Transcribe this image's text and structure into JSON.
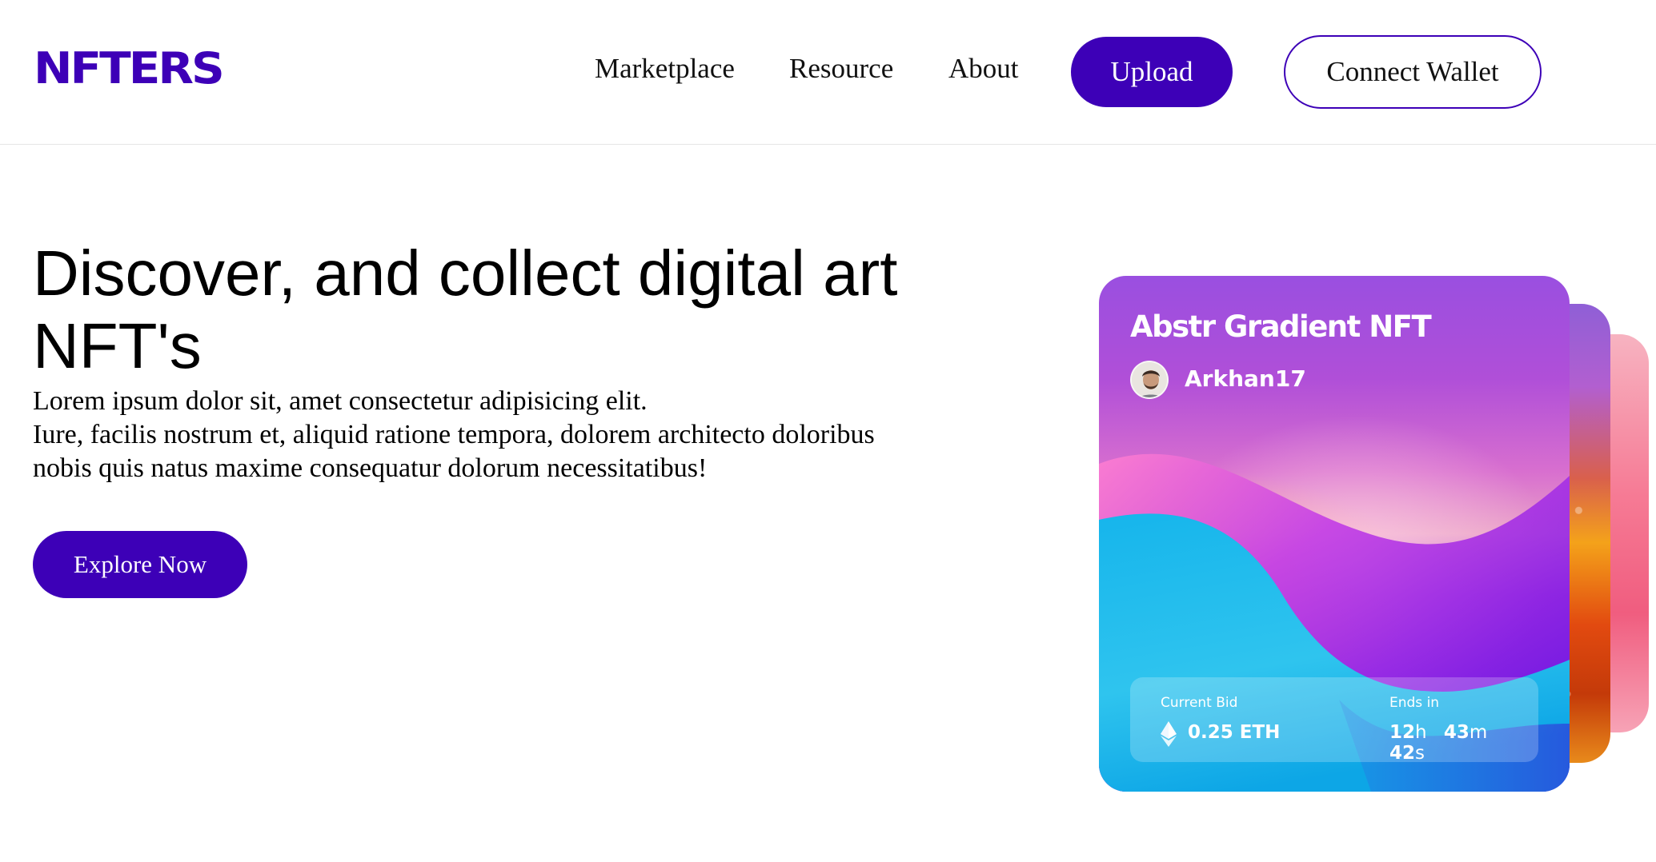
{
  "header": {
    "logo": "NFTERS",
    "nav": [
      "Marketplace",
      "Resource",
      "About"
    ],
    "upload_label": "Upload",
    "wallet_label": "Connect Wallet"
  },
  "hero": {
    "title_line1": "Discover, and collect digital art",
    "title_line2": "NFT's",
    "desc_line1": "Lorem ipsum dolor sit, amet consectetur adipisicing elit.",
    "desc_line2": "Iure, facilis nostrum et, aliquid ratione tempora, dolorem architecto doloribus",
    "desc_line3": "nobis quis natus maxime consequatur dolorum necessitatibus!",
    "cta_label": "Explore Now"
  },
  "card": {
    "title": "Abstr Gradient NFT",
    "owner": "Arkhan17",
    "bid_label": "Current Bid",
    "bid_value": "0.25 ETH",
    "ends_label": "Ends in",
    "ends_hours": "12",
    "ends_hours_unit": "h",
    "ends_minutes": "43",
    "ends_minutes_unit": "m",
    "ends_seconds": "42",
    "ends_seconds_unit": "s"
  },
  "colors": {
    "brand": "#3d00b7",
    "border": "#e6e6e6"
  },
  "icons": {
    "currency": "ethereum-icon",
    "owner": "avatar"
  }
}
